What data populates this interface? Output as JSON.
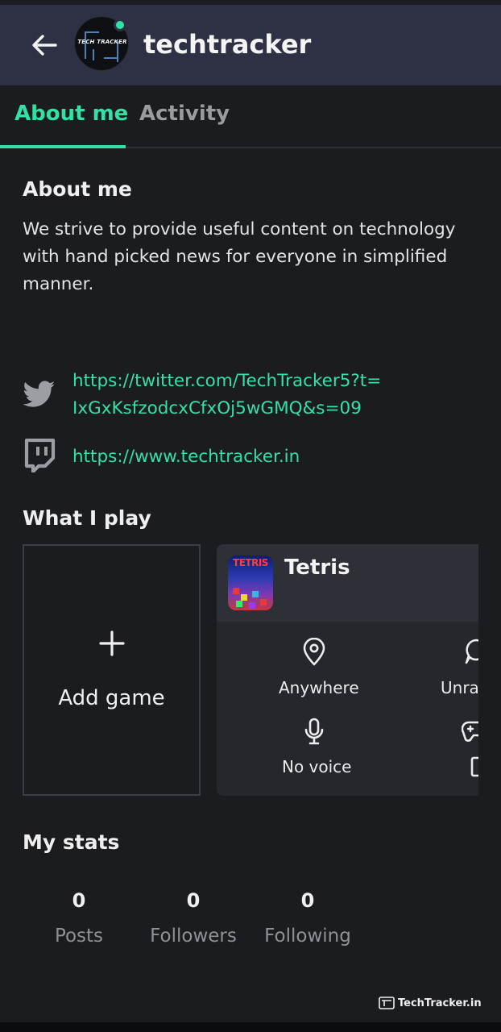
{
  "header": {
    "title": "techtracker",
    "avatar_text": "TECH TRACKER"
  },
  "tabs": [
    {
      "label": "About me",
      "active": true
    },
    {
      "label": "Activity",
      "active": false
    }
  ],
  "about": {
    "heading": "About me",
    "body": "We strive to provide useful content on technology with hand picked news for everyone in simplified manner."
  },
  "links": [
    {
      "icon": "twitter-icon",
      "line1": "https://twitter.com/TechTracker5?t=",
      "line2": "IxGxKsfzodcxCfxOj5wGMQ&s=09"
    },
    {
      "icon": "twitch-icon",
      "line1": "https://www.techtracker.in"
    }
  ],
  "what_i_play": {
    "heading": "What I play",
    "add_game_label": "Add game",
    "game": {
      "name": "Tetris",
      "thumb_logo": "TETRIS",
      "attributes": [
        {
          "icon": "location-pin-icon",
          "label": "Anywhere"
        },
        {
          "icon": "chat-bubble-icon",
          "label": "Unrar"
        },
        {
          "icon": "microphone-icon",
          "label": "No voice"
        },
        {
          "icon": "gamepad-icon",
          "label": ""
        }
      ]
    }
  },
  "stats": {
    "heading": "My stats",
    "items": [
      {
        "value": "0",
        "label": "Posts"
      },
      {
        "value": "0",
        "label": "Followers"
      },
      {
        "value": "0",
        "label": "Following"
      }
    ]
  },
  "watermark": "TechTracker.in",
  "colors": {
    "accent": "#35e0a6",
    "header_bg": "#2e3043",
    "page_bg": "#1a1c20",
    "card_bg": "#24272c"
  }
}
